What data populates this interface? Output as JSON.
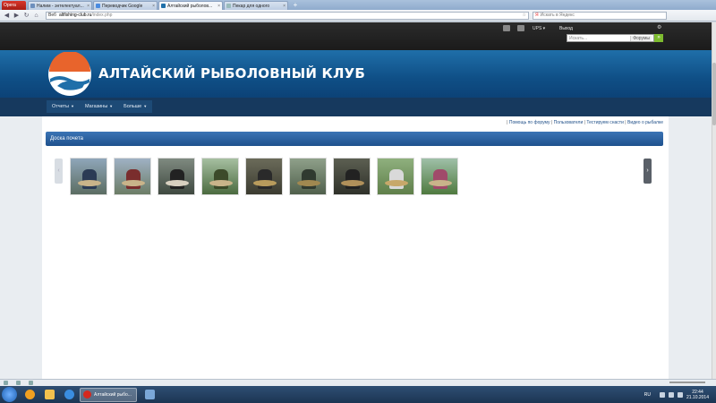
{
  "browser": {
    "menu_label": "Opera",
    "tabs": [
      {
        "title": "Налим - энтелектуал..."
      },
      {
        "title": "Переводчик Google"
      },
      {
        "title": "Алтайский рыболов..."
      },
      {
        "title": "Пекар для одного"
      }
    ],
    "new_tab": "+",
    "address": {
      "badge": "Веб",
      "host": "altfishing-club.ru",
      "path": "/index.php"
    },
    "search_placeholder": "Искать в Яндекс"
  },
  "site": {
    "top": {
      "ups": "UPS",
      "logout": "Выход",
      "search_placeholder": "Искать...",
      "search_scope": "Форумы",
      "search_go": "»"
    },
    "title": "АЛТАЙСКИЙ РЫБОЛОВНЫЙ КЛУБ",
    "menu": [
      {
        "label": "Отчеты"
      },
      {
        "label": "Магазины"
      },
      {
        "label": "Больше"
      }
    ],
    "toplinks": [
      "Помощь по форуму",
      "Пользователи",
      "Тестируем снасти",
      "Видео о рыбалке"
    ],
    "panel_title": "Доска почета",
    "carousel": {
      "prev": "‹",
      "next": "›"
    }
  },
  "taskbar": {
    "active_task": "Алтайский рыбо...",
    "lang": "RU",
    "time": "22:44",
    "date": "21.10.2014"
  },
  "colors": {
    "banner": "#1a5f98",
    "menubar": "#16395e",
    "panel_header": "#2d63a2",
    "search_go": "#7dbb2f"
  }
}
